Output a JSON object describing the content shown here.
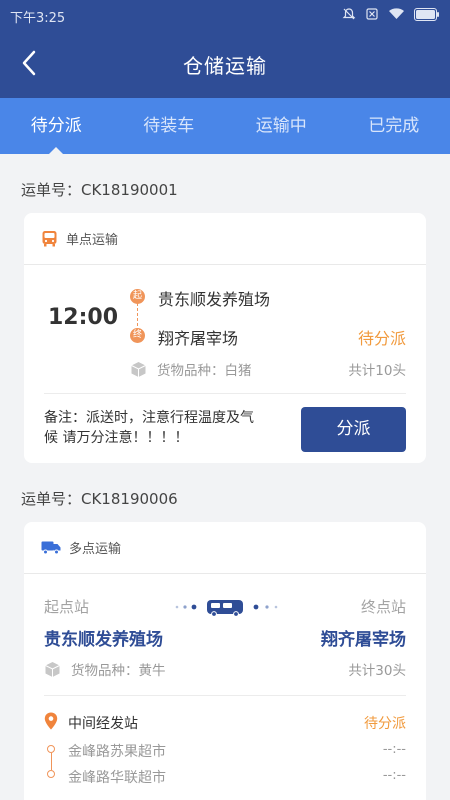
{
  "status_bar": {
    "time": "下午3:25"
  },
  "header": {
    "title": "仓储运输"
  },
  "tabs": [
    {
      "label": "待分派",
      "active": true
    },
    {
      "label": "待装车",
      "active": false
    },
    {
      "label": "运输中",
      "active": false
    },
    {
      "label": "已完成",
      "active": false
    }
  ],
  "orders": [
    {
      "order_no": "运单号：CK18190001",
      "type_label": "单点运输",
      "time": "12:00",
      "start_badge": "起",
      "end_badge": "终",
      "start": "贵东顺发养殖场",
      "end": "翔齐屠宰场",
      "status": "待分派",
      "goods": "货物品种：白猪",
      "total": "共计10头",
      "note": "备注：派送时，注意行程温度及气候 请万分注意！！！！",
      "action": "分派"
    },
    {
      "order_no": "运单号：CK18190006",
      "type_label": "多点运输",
      "start_label": "起点站",
      "end_label": "终点站",
      "start": "贵东顺发养殖场",
      "end": "翔齐屠宰场",
      "goods": "货物品种：黄牛",
      "total": "共计30头",
      "mid_title": "中间经发站",
      "status": "待分派",
      "mid_stops": [
        {
          "name": "金峰路苏果超市",
          "time": "--:--"
        },
        {
          "name": "金峰路华联超市",
          "time": "--:--"
        }
      ]
    }
  ],
  "colors": {
    "header_bg": "#2f4d96",
    "tab_bg": "#4a86e8",
    "accent_orange": "#f19a3d",
    "primary_button": "#2f4d96"
  },
  "icons": [
    "back-arrow-icon",
    "bus-icon",
    "box-icon",
    "truck-icon",
    "location-pin-icon"
  ]
}
